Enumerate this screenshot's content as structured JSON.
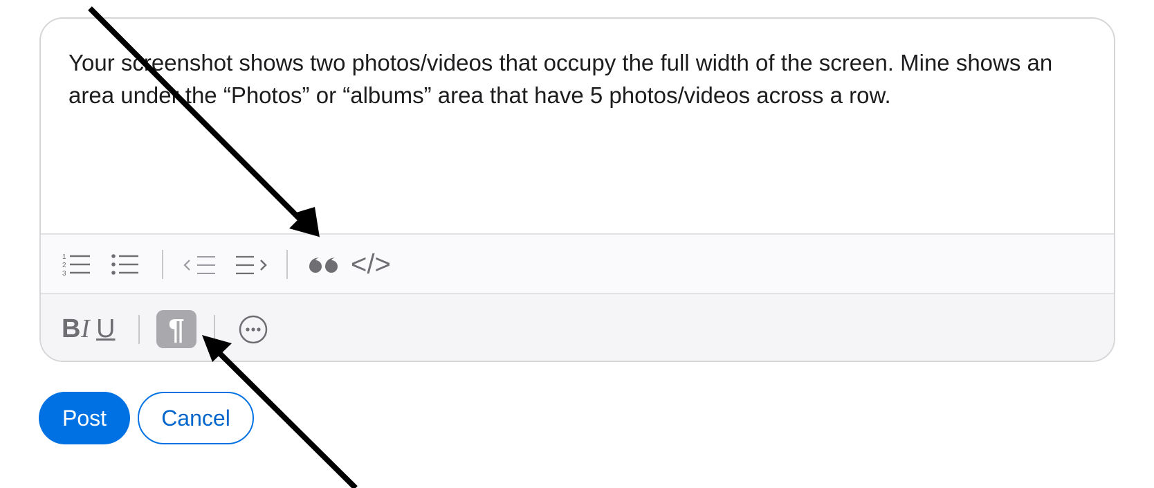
{
  "editor": {
    "body_text": "Your screenshot shows two photos/videos that occupy the full width of the screen. Mine shows an area under the “Photos” or “albums” area that have 5 photos/videos across a row."
  },
  "toolbar_top": {
    "icons": [
      "numbered-list-icon",
      "bulleted-list-icon",
      "outdent-icon",
      "indent-icon",
      "quote-icon",
      "code-icon"
    ],
    "code_label": "</>"
  },
  "toolbar_bottom": {
    "bold_label": "B",
    "italic_label": "I",
    "underline_label": "U",
    "paragraph_label": "¶",
    "icons": [
      "paragraph-icon",
      "more-options-icon"
    ]
  },
  "actions": {
    "post_label": "Post",
    "cancel_label": "Cancel"
  },
  "colors": {
    "accent": "#0071e3",
    "icon_gray": "#6e6e73",
    "annotation_arrow": "#000000"
  }
}
